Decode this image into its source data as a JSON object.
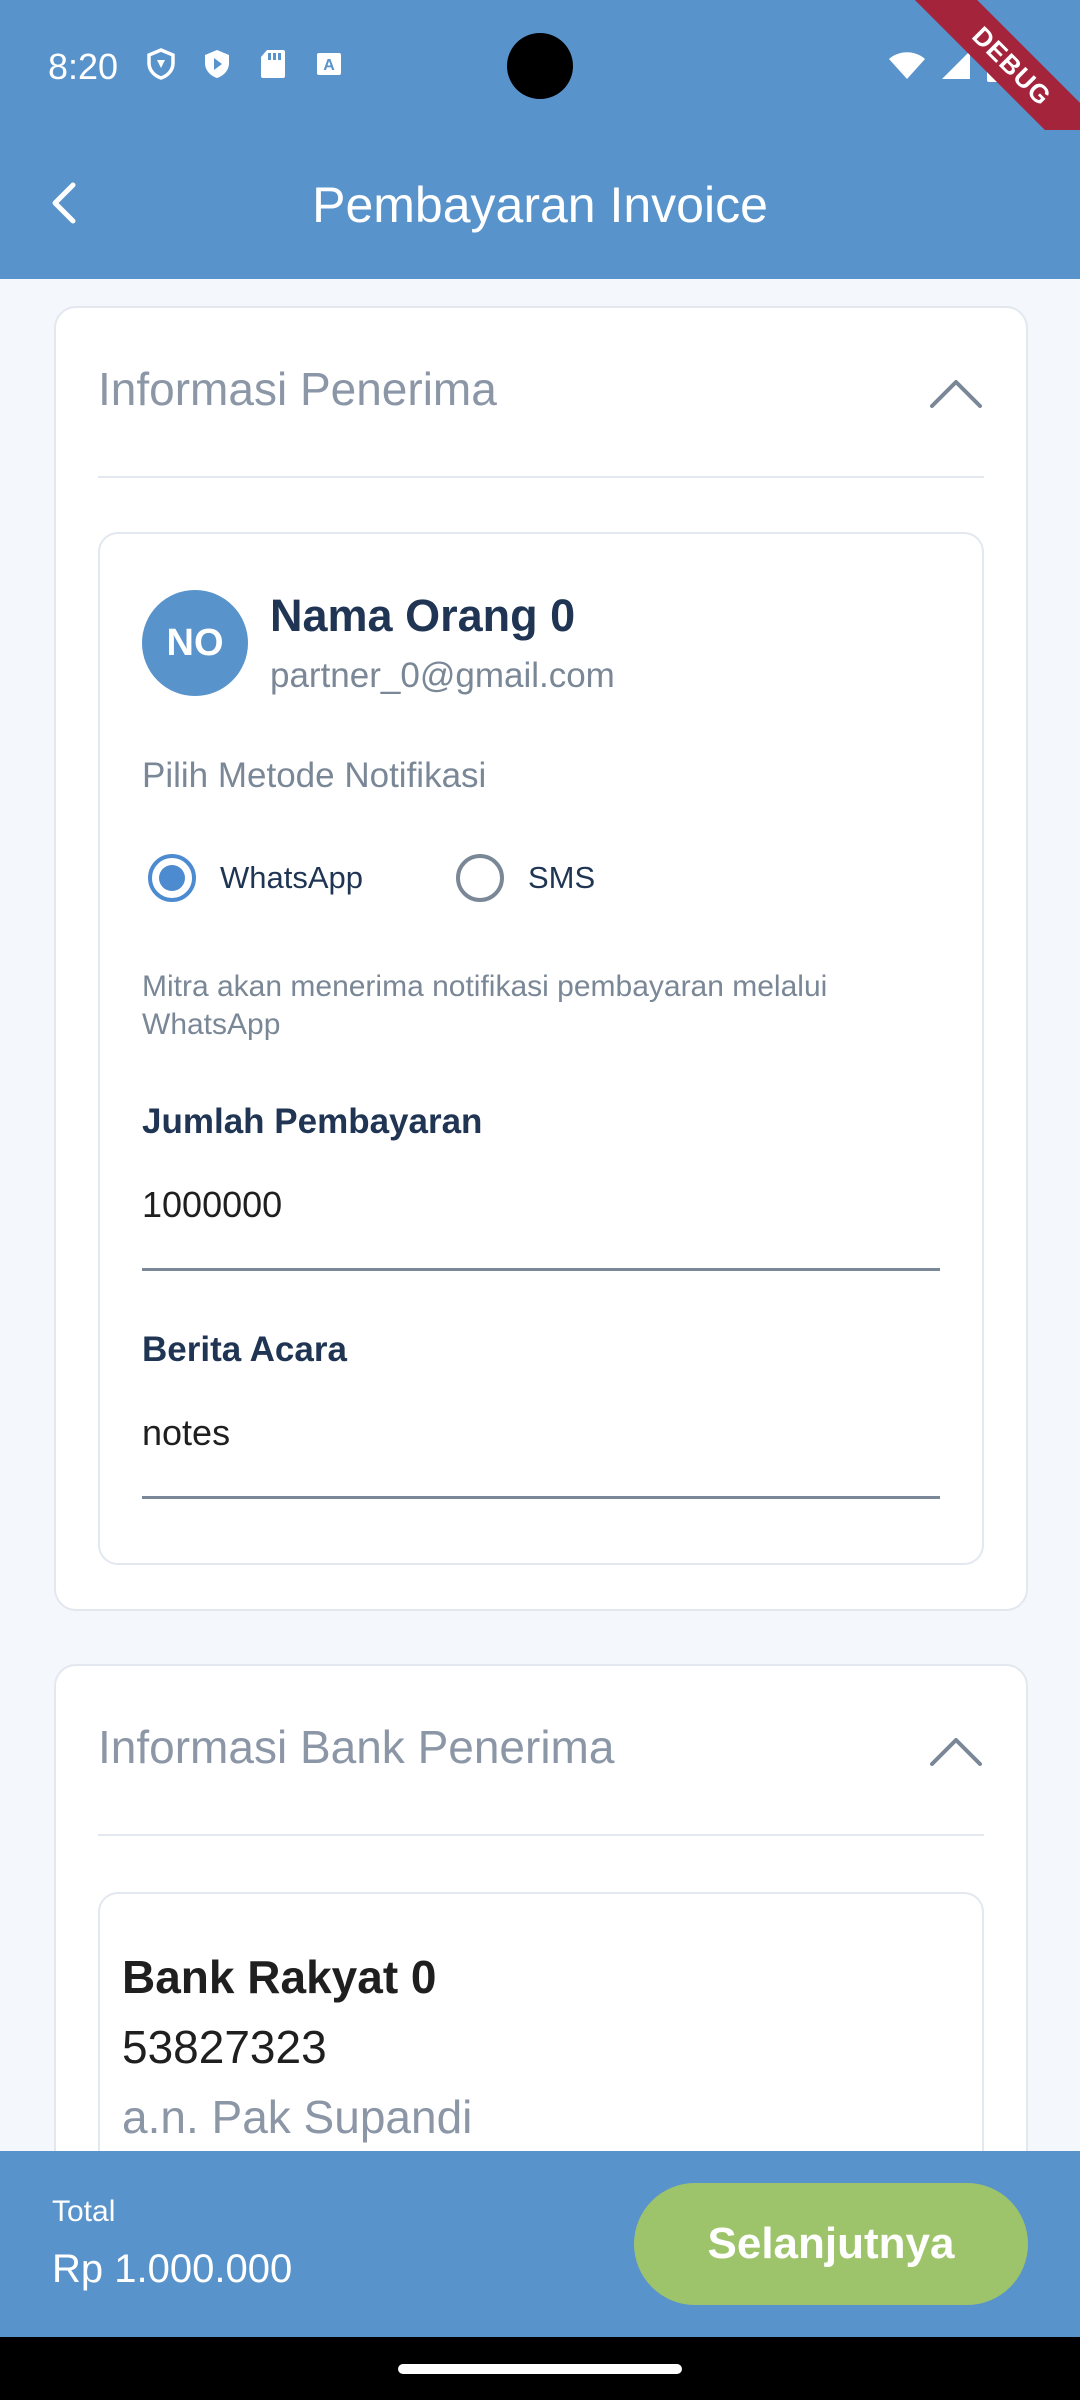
{
  "status_bar": {
    "time": "8:20",
    "left_icons": [
      "shield-outline-icon",
      "shield-play-icon",
      "sd-card-icon",
      "keyboard-a-icon"
    ],
    "right_icons": [
      "wifi-icon",
      "cellular-signal-icon",
      "battery-icon"
    ],
    "debug_label": "DEBUG"
  },
  "app_bar": {
    "title": "Pembayaran Invoice",
    "back_icon": "arrow-back-icon"
  },
  "recipient_section": {
    "title": "Informasi Penerima",
    "avatar_initials": "NO",
    "name": "Nama Orang 0",
    "email": "partner_0@gmail.com",
    "notification_label": "Pilih Metode Notifikasi",
    "options": [
      {
        "label": "WhatsApp",
        "selected": true
      },
      {
        "label": "SMS",
        "selected": false
      }
    ],
    "notification_info": "Mitra akan menerima notifikasi pembayaran melalui WhatsApp",
    "amount_label": "Jumlah Pembayaran",
    "amount_value": "1000000",
    "notes_label": "Berita Acara",
    "notes_value": "notes"
  },
  "bank_section": {
    "title": "Informasi Bank Penerima",
    "bank_name": "Bank Rakyat 0",
    "account_number": "53827323",
    "account_holder": "a.n. Pak Supandi"
  },
  "footer": {
    "total_label": "Total",
    "total_value": "Rp 1.000.000",
    "next_label": "Selanjutnya"
  },
  "colors": {
    "primary": "#5893cb",
    "button_green": "#9ec46b",
    "radio_blue": "#4d8bd1",
    "text_dark": "#1f3553",
    "text_muted": "#7a8796"
  }
}
